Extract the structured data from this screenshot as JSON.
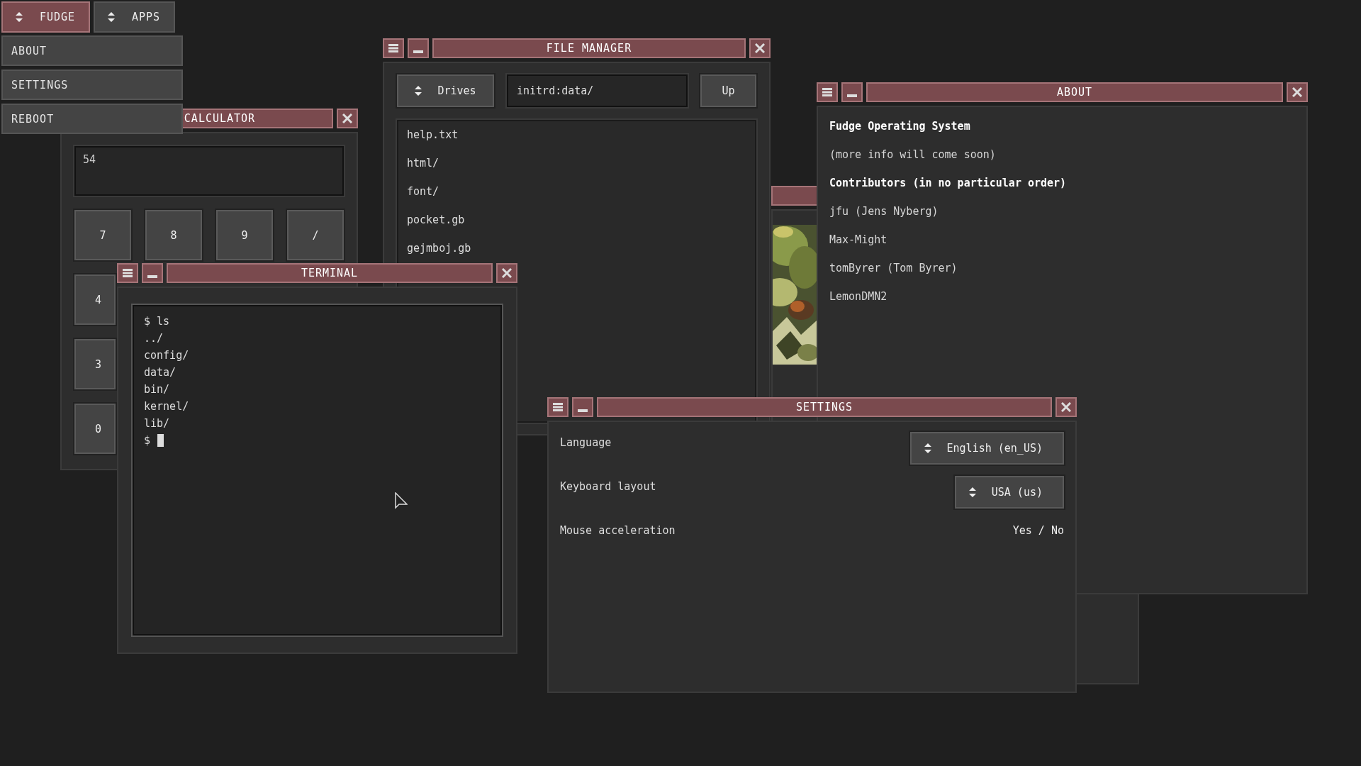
{
  "top_bar": {
    "buttons": [
      {
        "label": "FUDGE",
        "selected": true
      },
      {
        "label": "APPS",
        "selected": false
      }
    ]
  },
  "menu": {
    "items": [
      "ABOUT",
      "SETTINGS",
      "REBOOT"
    ]
  },
  "calculator": {
    "title": "CALCULATOR",
    "display": "54",
    "keys": [
      [
        "7",
        "8",
        "9",
        "/"
      ],
      [
        "4"
      ],
      [
        "3"
      ],
      [
        "0"
      ]
    ]
  },
  "file_manager": {
    "title": "FILE MANAGER",
    "drives_button": "Drives",
    "path": "initrd:data/",
    "up_button": "Up",
    "files": [
      "help.txt",
      "html/",
      "font/",
      "pocket.gb",
      "gejmboj.gb"
    ]
  },
  "about": {
    "title": "ABOUT",
    "lines": [
      {
        "text": "Fudge Operating System",
        "kind": "heading"
      },
      {
        "text": "(more info will come soon)",
        "kind": "normal"
      },
      {
        "text": "Contributors (in no particular order)",
        "kind": "heading"
      },
      {
        "text": "jfu (Jens Nyberg)",
        "kind": "normal"
      },
      {
        "text": "Max-Might",
        "kind": "normal"
      },
      {
        "text": "tomByrer (Tom Byrer)",
        "kind": "normal"
      },
      {
        "text": "LemonDMN2",
        "kind": "normal"
      }
    ]
  },
  "terminal": {
    "title": "TERMINAL",
    "lines": [
      "$ ls",
      "../",
      "config/",
      "data/",
      "bin/",
      "kernel/",
      "lib/"
    ],
    "prompt": "$"
  },
  "settings": {
    "title": "SETTINGS",
    "rows": [
      {
        "label": "Language",
        "kind": "select",
        "value": "English (en_US)"
      },
      {
        "label": "Keyboard layout",
        "kind": "select",
        "value": "USA (us)"
      },
      {
        "label": "Mouse acceleration",
        "kind": "toggle",
        "value": "Yes / No"
      }
    ]
  }
}
